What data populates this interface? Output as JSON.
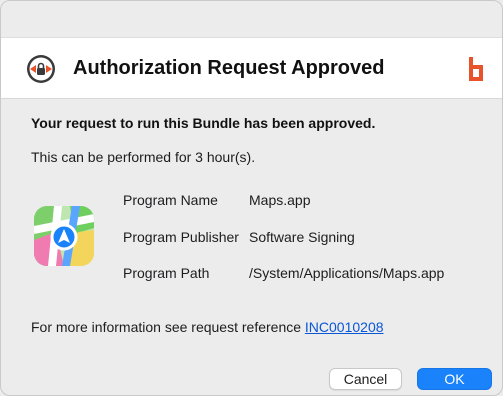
{
  "dialog": {
    "title": "Authorization Request Approved",
    "headline": "Your request to run this Bundle has been approved.",
    "duration_text": "This can be performed for 3 hour(s)."
  },
  "details": [
    {
      "label": "Program Name",
      "value": "Maps.app"
    },
    {
      "label": "Program Publisher",
      "value": "Software Signing"
    },
    {
      "label": "Program Path",
      "value": "/System/Applications/Maps.app"
    }
  ],
  "reference": {
    "prefix": "For more information see request reference ",
    "id": "INC0010208"
  },
  "buttons": {
    "cancel": "Cancel",
    "ok": "OK"
  },
  "icons": {
    "header": "authorization-lock-icon",
    "brand": "brand-logo-icon",
    "app": "maps-app-icon"
  },
  "colors": {
    "accent": "#1a82fb",
    "link": "#0a57d6",
    "brand": "#e8532b"
  }
}
